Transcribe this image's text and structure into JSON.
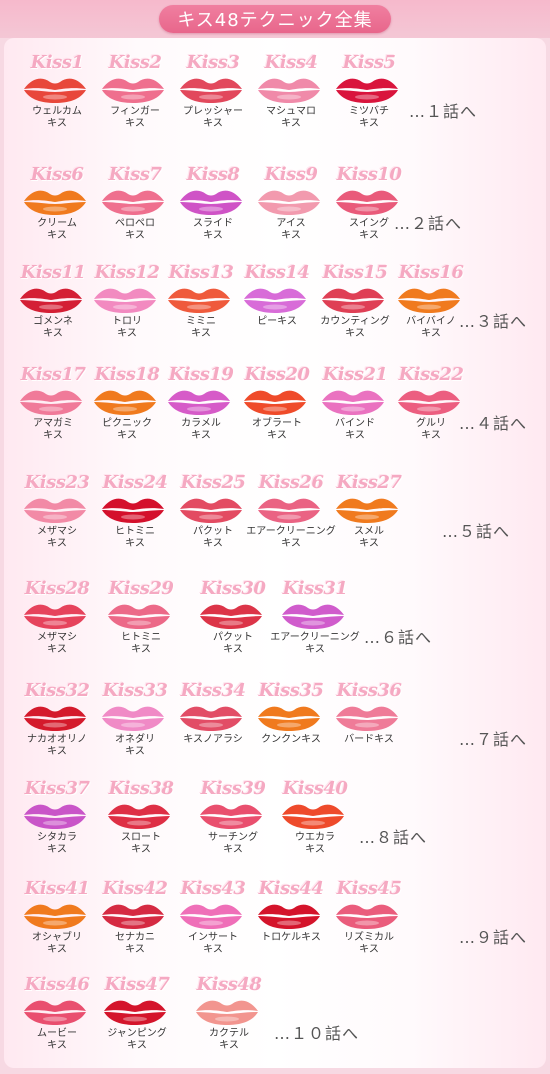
{
  "title": "キス48テクニック全集",
  "rows": [
    {
      "episode": "…１話へ",
      "kisses": [
        {
          "num": "Kiss1",
          "name": "ウェルカム\nキス",
          "color": "#e8473b"
        },
        {
          "num": "Kiss2",
          "name": "フィンガー\nキス",
          "color": "#ef6f8e"
        },
        {
          "num": "Kiss3",
          "name": "プレッシャー\nキス",
          "color": "#e2485c"
        },
        {
          "num": "Kiss4",
          "name": "マシュマロ\nキス",
          "color": "#f08aa9"
        },
        {
          "num": "Kiss5",
          "name": "ミツバチ\nキス",
          "color": "#d9143c"
        }
      ]
    },
    {
      "episode": "…２話へ",
      "kisses": [
        {
          "num": "Kiss6",
          "name": "クリーム\nキス",
          "color": "#f07a1e"
        },
        {
          "num": "Kiss7",
          "name": "ペロペロ\nキス",
          "color": "#ef6f8e"
        },
        {
          "num": "Kiss8",
          "name": "スライド\nキス",
          "color": "#cf53c6"
        },
        {
          "num": "Kiss9",
          "name": "アイス\nキス",
          "color": "#f29aae"
        },
        {
          "num": "Kiss10",
          "name": "スイング\nキス",
          "color": "#e95a7a"
        }
      ]
    },
    {
      "episode": "…３話へ",
      "kisses": [
        {
          "num": "Kiss11",
          "name": "ゴメンネ\nキス",
          "color": "#d41f35"
        },
        {
          "num": "Kiss12",
          "name": "トロリ\nキス",
          "color": "#f28ac0"
        },
        {
          "num": "Kiss13",
          "name": "ミミニ\nキス",
          "color": "#ef5a3c"
        },
        {
          "num": "Kiss14",
          "name": "ピーキス",
          "color": "#d86cd8"
        },
        {
          "num": "Kiss15",
          "name": "カウンティング\nキス",
          "color": "#df3f55"
        },
        {
          "num": "Kiss16",
          "name": "バイバイノ\nキス",
          "color": "#f07a1e"
        }
      ]
    },
    {
      "episode": "…４話へ",
      "kisses": [
        {
          "num": "Kiss17",
          "name": "アマガミ\nキス",
          "color": "#f07a99"
        },
        {
          "num": "Kiss18",
          "name": "ピクニック\nキス",
          "color": "#f07a1e"
        },
        {
          "num": "Kiss19",
          "name": "カラメル\nキス",
          "color": "#d65bc8"
        },
        {
          "num": "Kiss20",
          "name": "オブラート\nキス",
          "color": "#ef4b2a"
        },
        {
          "num": "Kiss21",
          "name": "バインド\nキス",
          "color": "#ea72c0"
        },
        {
          "num": "Kiss22",
          "name": "グルリ\nキス",
          "color": "#ec5e80"
        }
      ]
    },
    {
      "episode": "…５話へ",
      "kisses": [
        {
          "num": "Kiss23",
          "name": "メザマシ\nキス",
          "color": "#f28aa6"
        },
        {
          "num": "Kiss24",
          "name": "ヒトミニ\nキス",
          "color": "#d4102c"
        },
        {
          "num": "Kiss25",
          "name": "パクット\nキス",
          "color": "#e34b62"
        },
        {
          "num": "Kiss26",
          "name": "エアークリーニング\nキス",
          "color": "#ea6383"
        },
        {
          "num": "Kiss27",
          "name": "スメル\nキス",
          "color": "#f07a1e"
        }
      ]
    },
    {
      "episode": "…６話へ",
      "kisses": [
        {
          "num": "Kiss28",
          "name": "メザマシ\nキス",
          "color": "#e6435c"
        },
        {
          "num": "Kiss29",
          "name": "ヒトミニ\nキス",
          "color": "#ec6988"
        },
        {
          "num": "Kiss30",
          "name": "パクット\nキス",
          "color": "#dc3448"
        },
        {
          "num": "Kiss31",
          "name": "エアークリーニング\nキス",
          "color": "#d05ccc"
        }
      ]
    },
    {
      "episode": "…７話へ",
      "kisses": [
        {
          "num": "Kiss32",
          "name": "ナカオオリノ\nキス",
          "color": "#d41a2c"
        },
        {
          "num": "Kiss33",
          "name": "オネダリ\nキス",
          "color": "#f08ac6"
        },
        {
          "num": "Kiss34",
          "name": "キスノアラシ",
          "color": "#e24d66"
        },
        {
          "num": "Kiss35",
          "name": "クンクンキス",
          "color": "#f07a1e"
        },
        {
          "num": "Kiss36",
          "name": "バードキス",
          "color": "#ef7b98"
        }
      ]
    },
    {
      "episode": "…８話へ",
      "kisses": [
        {
          "num": "Kiss37",
          "name": "シタカラ\nキス",
          "color": "#c955c8"
        },
        {
          "num": "Kiss38",
          "name": "スロート\nキス",
          "color": "#de2f45"
        },
        {
          "num": "Kiss39",
          "name": "サーチング\nキス",
          "color": "#e94f6e"
        },
        {
          "num": "Kiss40",
          "name": "ウエカラ\nキス",
          "color": "#ee4a2b"
        }
      ]
    },
    {
      "episode": "…９話へ",
      "kisses": [
        {
          "num": "Kiss41",
          "name": "オシャブリ\nキス",
          "color": "#f07a1e"
        },
        {
          "num": "Kiss42",
          "name": "セナカニ\nキス",
          "color": "#d52a42"
        },
        {
          "num": "Kiss43",
          "name": "インサート\nキス",
          "color": "#ef6fb8"
        },
        {
          "num": "Kiss44",
          "name": "トロケルキス",
          "color": "#d4142b"
        },
        {
          "num": "Kiss45",
          "name": "リズミカル\nキス",
          "color": "#ea5c7c"
        }
      ]
    },
    {
      "episode": "…１０話へ",
      "kisses": [
        {
          "num": "Kiss46",
          "name": "ムービー\nキス",
          "color": "#e94f6f"
        },
        {
          "num": "Kiss47",
          "name": "ジャンピング\nキス",
          "color": "#d4142b"
        },
        {
          "num": "Kiss48",
          "name": "カクテル\nキス",
          "color": "#f2958f"
        }
      ]
    }
  ]
}
